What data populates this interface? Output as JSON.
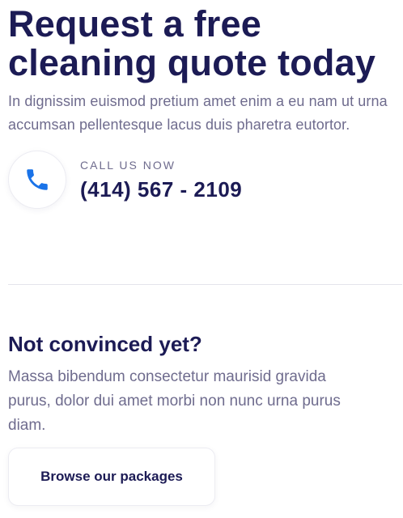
{
  "hero": {
    "title_line1": "Request a free",
    "title_line2": "cleaning quote today",
    "description": "In dignissim euismod pretium amet enim a eu nam ut urna accumsan pellentesque lacus duis pharetra eutortor."
  },
  "contact": {
    "icon": "phone-icon",
    "label": "CALL US NOW",
    "phone": "(414) 567 - 2109"
  },
  "secondary": {
    "title": "Not convinced yet?",
    "description": "Massa bibendum consectetur maurisid gravida purus, dolor dui amet morbi non nunc urna purus diam.",
    "button_label": "Browse our packages"
  },
  "colors": {
    "heading": "#1c1b55",
    "body_text": "#6f6c8e",
    "accent": "#1a73e8",
    "divider": "#e4e4ec"
  }
}
